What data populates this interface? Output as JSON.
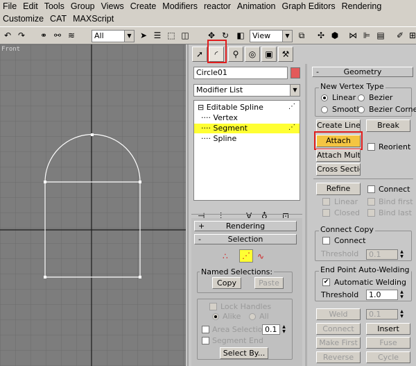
{
  "menu": {
    "row1": [
      "File",
      "Edit",
      "Tools",
      "Group",
      "Views",
      "Create",
      "Modifiers",
      "reactor",
      "Animation",
      "Graph Editors",
      "Rendering"
    ],
    "row2": [
      "Customize",
      "CAT",
      "MAXScript"
    ]
  },
  "toolbar": {
    "selection_filter": "All",
    "reference_coord": "View"
  },
  "viewport": {
    "label": "Front"
  },
  "object": {
    "name": "Circle01",
    "color": "#e35a5a"
  },
  "modifier_list": {
    "label": "Modifier List"
  },
  "stack": {
    "root": "Editable Spline",
    "items": [
      "Vertex",
      "Segment",
      "Spline"
    ],
    "selected": "Segment"
  },
  "left_rollouts": {
    "rendering": {
      "sign": "+",
      "label": "Rendering"
    },
    "selection": {
      "sign": "-",
      "label": "Selection"
    },
    "named_selections": {
      "title": "Named Selections:",
      "copy": "Copy",
      "paste": "Paste"
    },
    "lock_handles": "Lock Handles",
    "alike": "Alike",
    "all": "All",
    "area_selection": "Area Selection:",
    "area_value": "0.1",
    "segment_end": "Segment End",
    "select_by": "Select By..."
  },
  "geometry": {
    "header": {
      "sign": "-",
      "label": "Geometry"
    },
    "new_vertex_type": {
      "title": "New Vertex Type",
      "linear": "Linear",
      "bezier": "Bezier",
      "smooth": "Smooth",
      "bezier_corner": "Bezier Corner"
    },
    "create_line": "Create Line",
    "break": "Break",
    "attach": "Attach",
    "reorient": "Reorient",
    "attach_mult": "Attach Mult.",
    "cross_section": "Cross Section",
    "refine": "Refine",
    "connect": "Connect",
    "linear": "Linear",
    "bind_first": "Bind first",
    "closed": "Closed",
    "bind_last": "Bind last",
    "connect_copy": {
      "title": "Connect Copy",
      "connect": "Connect",
      "threshold": "Threshold",
      "value": "0.1"
    },
    "end_point_welding": {
      "title": "End Point Auto-Welding",
      "automatic": "Automatic Welding",
      "threshold": "Threshold",
      "value": "1.0"
    },
    "weld": "Weld",
    "weld_value": "0.1",
    "connect_btn": "Connect",
    "insert": "Insert",
    "make_first": "Make First",
    "fuse": "Fuse",
    "reverse": "Reverse",
    "cycle": "Cycle"
  },
  "colors": {
    "highlight": "#f4c542",
    "annotation": "#e01d1d",
    "viewport_bg": "#7d7d7d"
  }
}
